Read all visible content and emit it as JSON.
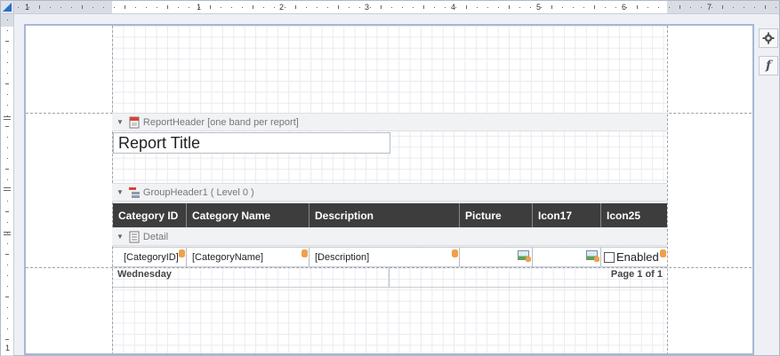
{
  "rulers": {
    "horizontal_numbers": [
      "1",
      "1",
      "2",
      "3",
      "4",
      "5",
      "6",
      "7"
    ],
    "vertical_numbers": [
      "1"
    ]
  },
  "tools": {
    "settings_icon": "gear-icon",
    "function_label": "f"
  },
  "bands": {
    "report_header": "ReportHeader [one band per report]",
    "group_header": "GroupHeader1 ( Level 0 )",
    "detail": "Detail"
  },
  "report_title": "Report Title",
  "header_columns": [
    "Category ID",
    "Category Name",
    "Description",
    "Picture",
    "Icon17",
    "Icon25"
  ],
  "detail_cells": {
    "category_id": "[CategoryID]",
    "category_name": "[CategoryName]",
    "description": "[Description]",
    "enabled": "Enabled"
  },
  "footer": {
    "left": "Wednesday",
    "right": "Page 1 of 1"
  },
  "colors": {
    "table_header_bg": "#3d3d3d",
    "page_border": "#a7b8d4",
    "accent_orange": "#f0a04b"
  }
}
